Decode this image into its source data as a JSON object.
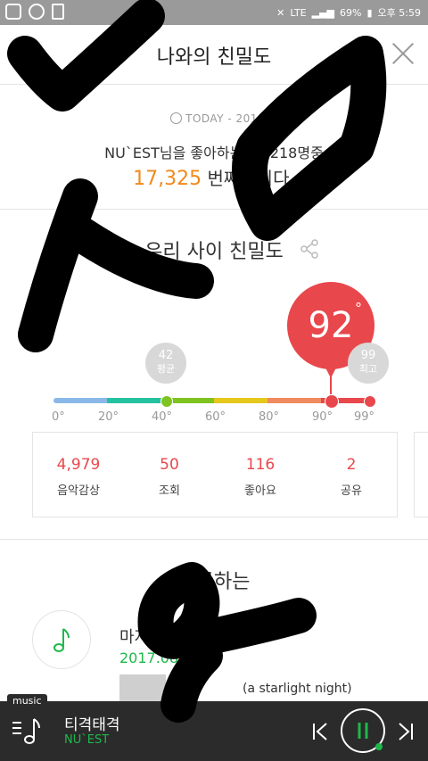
{
  "status": {
    "lte": "LTE",
    "battery": "69%",
    "time": "오후 5:59"
  },
  "header": {
    "title": "나와의 친밀도"
  },
  "today": {
    "label": "TODAY - 201",
    "line1": "NU`EST님을 좋아하는 46,218명중",
    "rank": "17,325",
    "rank_suffix": "번째입니다."
  },
  "intimacy": {
    "title": "우리 사이 친밀도",
    "score": "92",
    "degree_symbol": "°",
    "avg_value": "42",
    "avg_label": "평균",
    "max_value": "99",
    "max_label": "최고",
    "scale_value": 92,
    "ticks": [
      "0°",
      "20°",
      "40°",
      "60°",
      "80°",
      "90°",
      "99°"
    ],
    "scale_colors": [
      "#8ab8e8",
      "#26c2a0",
      "#7ec320",
      "#e6c81c",
      "#f08a60",
      "#e8474c"
    ]
  },
  "stats": [
    {
      "value": "4,979",
      "label": "음악감상"
    },
    {
      "value": "50",
      "label": "조회"
    },
    {
      "value": "116",
      "label": "좋아요"
    },
    {
      "value": "2",
      "label": "공유"
    }
  ],
  "history": {
    "title": "기록하는",
    "item_title": "마지",
    "item_date": "2017.08",
    "item_song": "(a starlight night)"
  },
  "player": {
    "tag": "music",
    "title": "티격태격",
    "artist": "NU`EST"
  },
  "colors": {
    "accent": "#e8474c",
    "green": "#1eb84a",
    "orange": "#f08a1c"
  }
}
